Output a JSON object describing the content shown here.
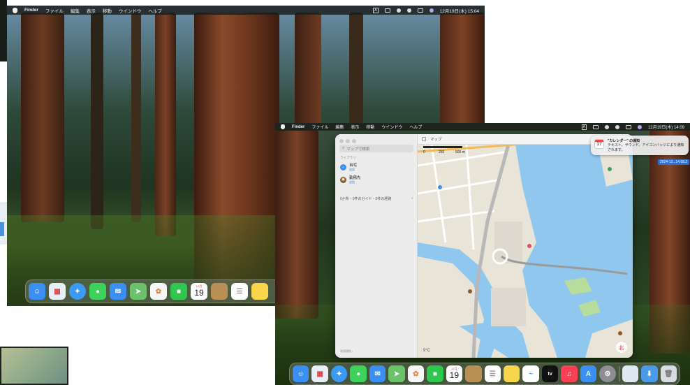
{
  "screen1": {
    "menubar": {
      "app": "Finder",
      "items": [
        "ファイル",
        "編集",
        "表示",
        "移動",
        "ウインドウ",
        "ヘルプ"
      ],
      "input_indicator": "A",
      "datetime": "12月19日(木) 15:04"
    },
    "dock": [
      {
        "name": "finder",
        "color": "#3b8ef3"
      },
      {
        "name": "launchpad",
        "color": "#e8eef5"
      },
      {
        "name": "safari",
        "color": "#3a9af5"
      },
      {
        "name": "messages",
        "color": "#3dd35a"
      },
      {
        "name": "mail",
        "color": "#3b8ef3"
      },
      {
        "name": "maps",
        "color": "#6ac36a"
      },
      {
        "name": "photos",
        "color": "#f6f6f6"
      },
      {
        "name": "facetime",
        "color": "#30c74e"
      },
      {
        "name": "calendar",
        "color": "#ffffff",
        "month": "12月",
        "day": "19"
      },
      {
        "name": "contacts",
        "color": "#b88f55"
      },
      {
        "name": "reminders",
        "color": "#ffffff"
      },
      {
        "name": "notes",
        "color": "#f8d54b"
      }
    ]
  },
  "screen2": {
    "menubar": {
      "app": "Finder",
      "items": [
        "ファイル",
        "編集",
        "表示",
        "移動",
        "ウインドウ",
        "ヘルプ"
      ],
      "input_indicator": "A",
      "datetime": "12月19日(木) 14:09"
    },
    "maps": {
      "search_placeholder": "マップで検索",
      "library_label": "ライブラリ",
      "favorites": [
        {
          "title": "自宅",
          "sub": "追加",
          "color": "#3a8ff0",
          "glyph": "⌂"
        },
        {
          "title": "勤務先",
          "sub": "追加",
          "color": "#8a5a2b",
          "glyph": "▣"
        }
      ],
      "guides_text": "0か所・0件のガイド・0件の経路",
      "terms": "利用規約 ›",
      "toolbar_title": "マップ",
      "scale": [
        "0",
        "250",
        "500 m"
      ],
      "weather": "9°C",
      "compass": "北",
      "colors": {
        "water": "#8fc7ee",
        "land": "#e9e4d8",
        "road": "#ffffff",
        "highway": "#f2b957",
        "park": "#b7dc9c"
      }
    },
    "notification": {
      "title": "\"カレンダー\" の通知",
      "body": "テキスト、サウンド、アイコンバッジにより通知されます。",
      "day": "17"
    },
    "date_badge": "2024-12...14.08.2",
    "dock": [
      {
        "name": "finder",
        "color": "#3b8ef3"
      },
      {
        "name": "launchpad",
        "color": "#e8eef5"
      },
      {
        "name": "safari",
        "color": "#3a9af5"
      },
      {
        "name": "messages",
        "color": "#3dd35a"
      },
      {
        "name": "mail",
        "color": "#3b8ef3"
      },
      {
        "name": "maps",
        "color": "#6ac36a"
      },
      {
        "name": "photos",
        "color": "#f6f6f6"
      },
      {
        "name": "facetime",
        "color": "#30c74e"
      },
      {
        "name": "calendar",
        "color": "#ffffff",
        "month": "12月",
        "day": "19"
      },
      {
        "name": "contacts",
        "color": "#b88f55"
      },
      {
        "name": "reminders",
        "color": "#ffffff"
      },
      {
        "name": "notes",
        "color": "#f8d54b"
      },
      {
        "name": "freeform",
        "color": "#ffffff"
      },
      {
        "name": "tv",
        "color": "#111111",
        "label": "tv"
      },
      {
        "name": "music",
        "color": "#fa4055"
      },
      {
        "name": "app-store",
        "color": "#3a8ff0"
      },
      {
        "name": "system-settings",
        "color": "#8e8e93"
      },
      {
        "name": "preview",
        "color": "#dfe8f3"
      },
      {
        "name": "downloads",
        "color": "#4a9ae8"
      },
      {
        "name": "trash",
        "color": "#d9dde2"
      }
    ]
  }
}
